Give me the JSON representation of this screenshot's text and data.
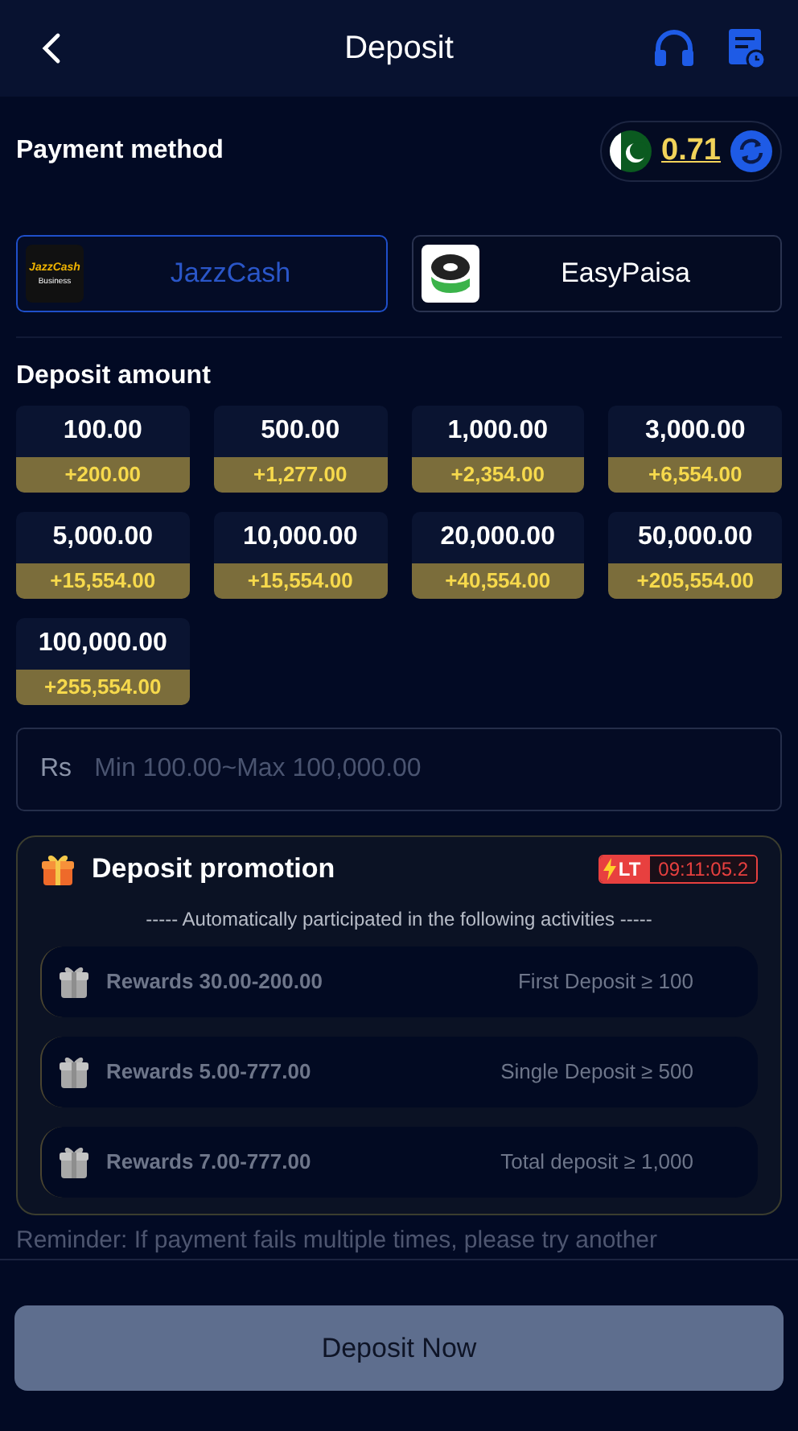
{
  "header": {
    "title": "Deposit"
  },
  "payment": {
    "label": "Payment method",
    "balance": "0.71",
    "methods": [
      {
        "name": "JazzCash",
        "logo_text": "JazzCash",
        "logo_sub": "Business",
        "kind": "jazz",
        "selected": true
      },
      {
        "name": "EasyPaisa",
        "kind": "easy",
        "selected": false
      }
    ]
  },
  "amounts": {
    "label": "Deposit amount",
    "items": [
      {
        "amount": "100.00",
        "bonus": "+200.00"
      },
      {
        "amount": "500.00",
        "bonus": "+1,277.00"
      },
      {
        "amount": "1,000.00",
        "bonus": "+2,354.00"
      },
      {
        "amount": "3,000.00",
        "bonus": "+6,554.00"
      },
      {
        "amount": "5,000.00",
        "bonus": "+15,554.00"
      },
      {
        "amount": "10,000.00",
        "bonus": "+15,554.00"
      },
      {
        "amount": "20,000.00",
        "bonus": "+40,554.00"
      },
      {
        "amount": "50,000.00",
        "bonus": "+205,554.00"
      },
      {
        "amount": "100,000.00",
        "bonus": "+255,554.00"
      }
    ]
  },
  "amount_field": {
    "prefix": "Rs",
    "placeholder": "Min 100.00~Max 100,000.00"
  },
  "promotion": {
    "title": "Deposit promotion",
    "badge": "LT",
    "timer": "09:11:05.2",
    "subtitle": "----- Automatically participated in the following activities -----",
    "activities": [
      {
        "reward": "Rewards 30.00-200.00",
        "condition": "First Deposit ≥ 100"
      },
      {
        "reward": "Rewards 5.00-777.00",
        "condition": "Single Deposit ≥ 500"
      },
      {
        "reward": "Rewards 7.00-777.00",
        "condition": "Total deposit ≥ 1,000"
      }
    ]
  },
  "reminder": "Reminder: If payment fails multiple times, please try another",
  "submit": {
    "label": "Deposit Now"
  }
}
